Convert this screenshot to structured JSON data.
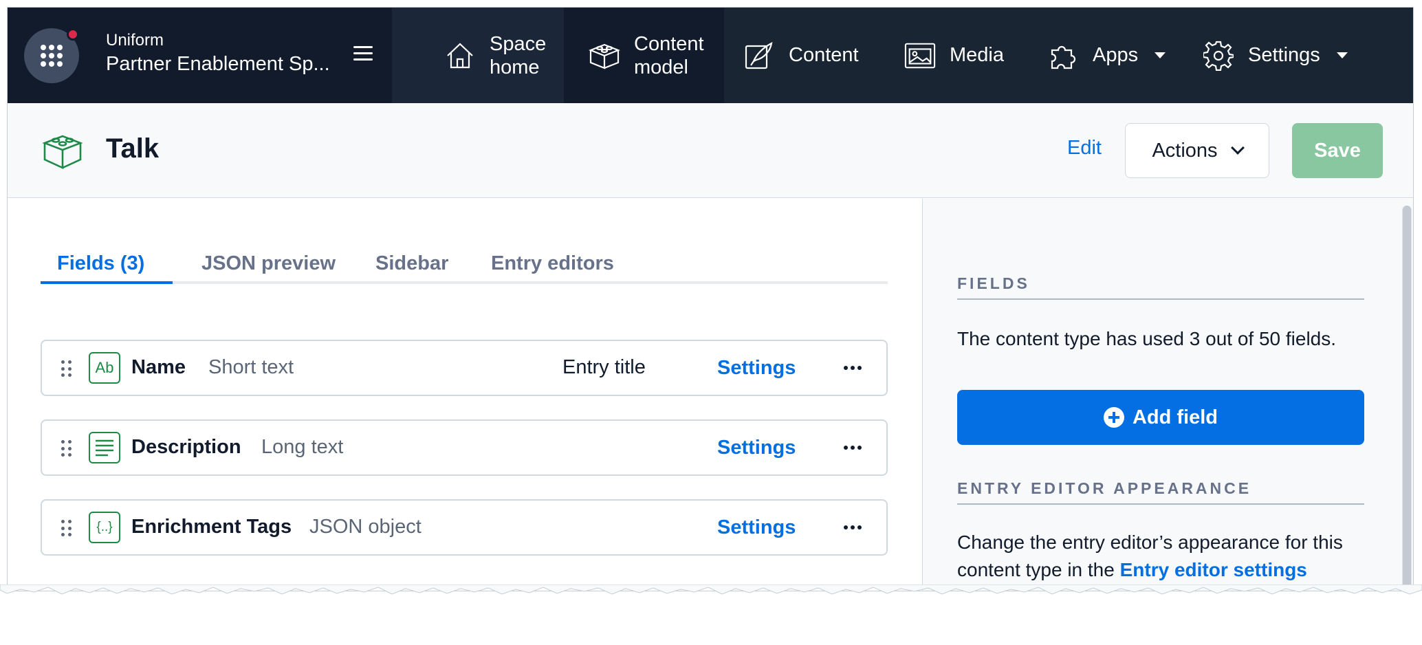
{
  "topbar": {
    "org_name": "Uniform",
    "space_name": "Partner Enablement Sp...",
    "nav": [
      {
        "label_line1": "Space",
        "label_line2": "home",
        "icon": "home-icon"
      },
      {
        "label_line1": "Content",
        "label_line2": "model",
        "icon": "content-model-icon"
      },
      {
        "label": "Content",
        "icon": "content-icon"
      },
      {
        "label": "Media",
        "icon": "media-icon"
      },
      {
        "label": "Apps",
        "icon": "puzzle-icon"
      },
      {
        "label": "Settings",
        "icon": "gear-icon"
      }
    ]
  },
  "header": {
    "title": "Talk",
    "edit_label": "Edit",
    "actions_label": "Actions",
    "save_label": "Save"
  },
  "tabs": [
    {
      "label": "Fields (3)",
      "active": true
    },
    {
      "label": "JSON preview"
    },
    {
      "label": "Sidebar"
    },
    {
      "label": "Entry editors"
    }
  ],
  "fields": [
    {
      "icon_text": "Ab",
      "name": "Name",
      "type": "Short text",
      "badge": "Entry title",
      "settings_label": "Settings"
    },
    {
      "icon_text": "",
      "name": "Description",
      "type": "Long text",
      "settings_label": "Settings"
    },
    {
      "icon_text": "{..}",
      "name": "Enrichment Tags",
      "type": "JSON object",
      "settings_label": "Settings"
    }
  ],
  "sidebar": {
    "fields_title": "FIELDS",
    "fields_text": "The content type has used 3 out of 50 fields.",
    "add_field_label": "Add field",
    "appearance_title": "ENTRY EDITOR APPEARANCE",
    "appearance_text": "Change the entry editor’s appearance for this content type in the",
    "appearance_link": "Entry editor settings"
  },
  "colors": {
    "nav_bg": "#192532",
    "accent_blue": "#036fe3",
    "brand_green": "#1f8a48",
    "save_disabled": "#89c7a0",
    "notify_red": "#da294a"
  }
}
